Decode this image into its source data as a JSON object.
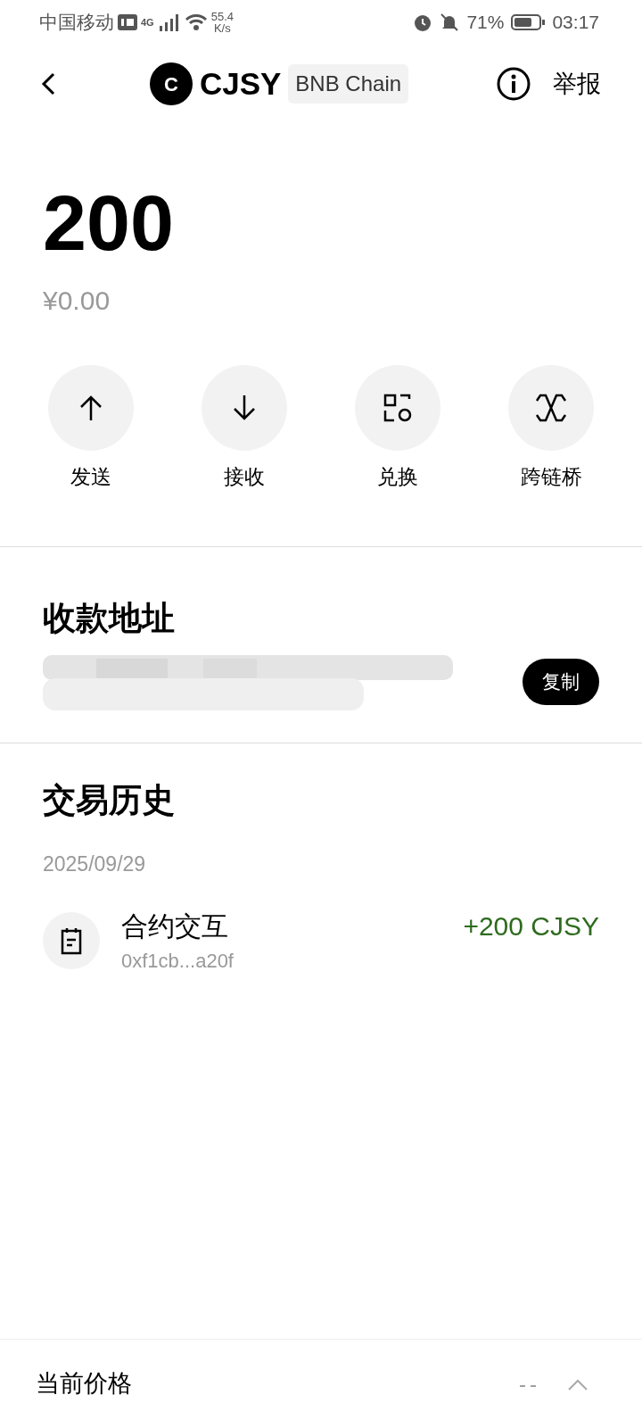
{
  "status_bar": {
    "carrier": "中国移动",
    "network": "4G",
    "speed": "55.4",
    "speed_unit": "K/s",
    "battery": "71%",
    "time": "03:17"
  },
  "header": {
    "token_letter": "C",
    "token": "CJSY",
    "chain": "BNB Chain",
    "report": "举报"
  },
  "balance": {
    "amount": "200",
    "fiat": "¥0.00"
  },
  "actions": [
    {
      "label": "发送",
      "kind": "send"
    },
    {
      "label": "接收",
      "kind": "receive"
    },
    {
      "label": "兑换",
      "kind": "swap"
    },
    {
      "label": "跨链桥",
      "kind": "bridge"
    }
  ],
  "address": {
    "title": "收款地址",
    "copy": "复制"
  },
  "history": {
    "title": "交易历史",
    "groups": [
      {
        "date": "2025/09/29",
        "items": [
          {
            "title": "合约交互",
            "hash": "0xf1cb...a20f",
            "amount": "+200 CJSY",
            "color": "#2e6b1f"
          }
        ]
      }
    ]
  },
  "price": {
    "label": "当前价格",
    "value": "--"
  }
}
